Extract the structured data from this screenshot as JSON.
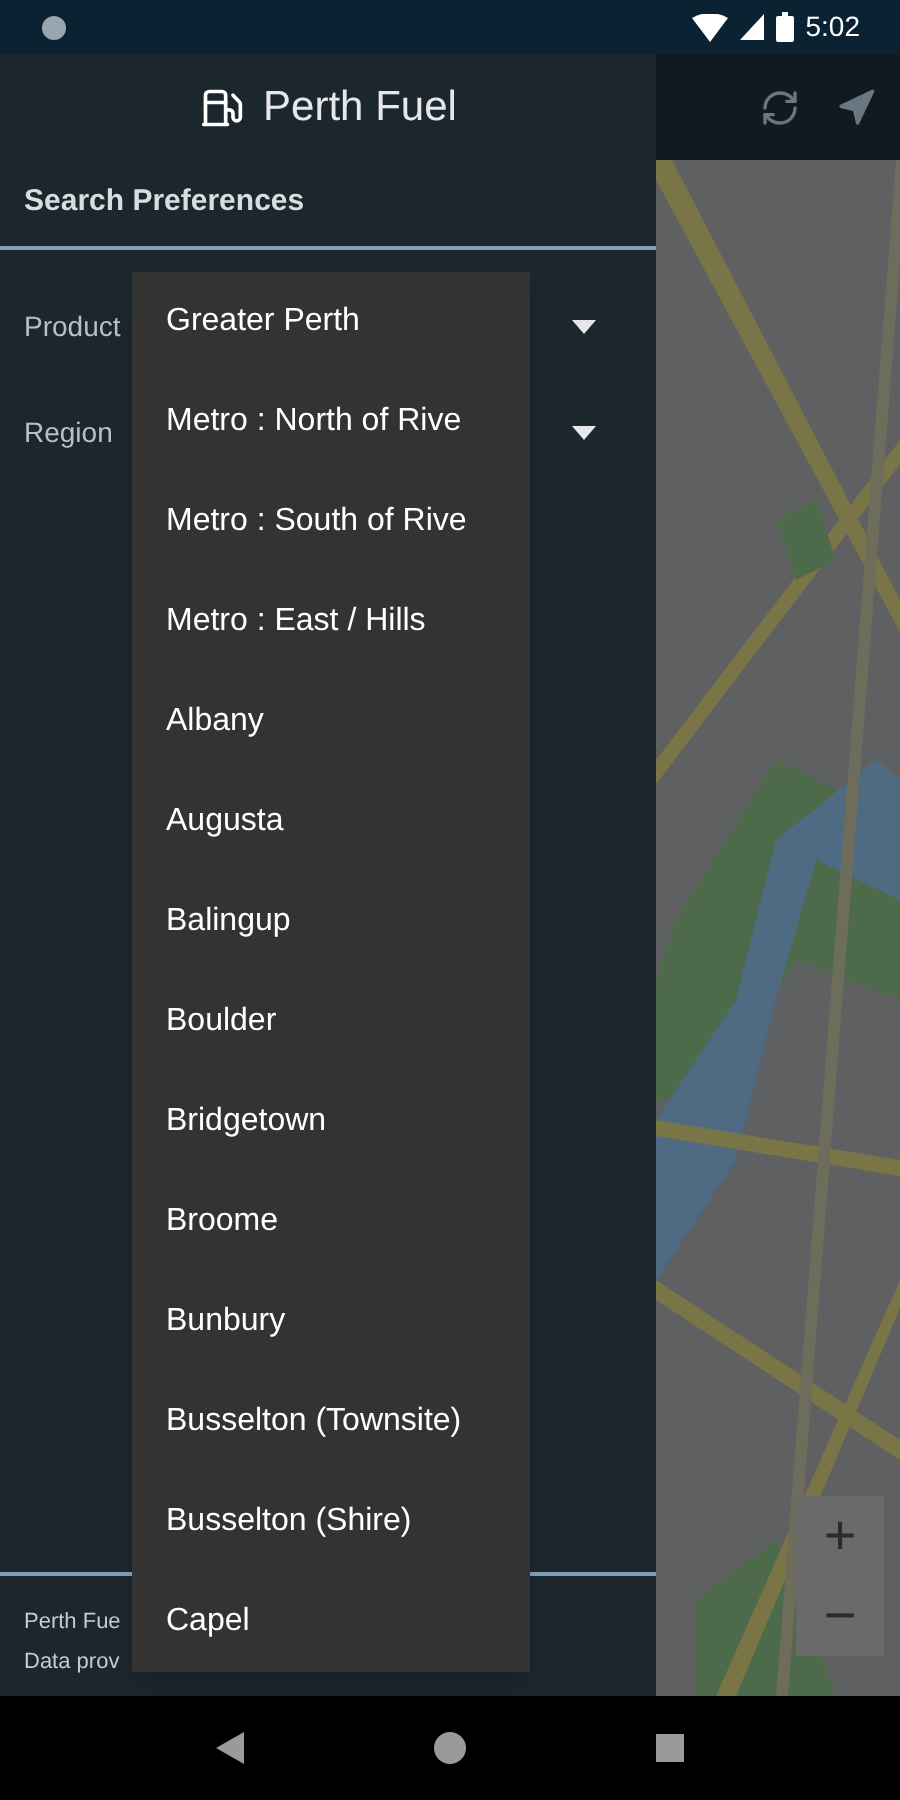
{
  "status_bar": {
    "time": "5:02"
  },
  "drawer": {
    "title": "Perth Fuel",
    "section": "Search Preferences",
    "fields": [
      {
        "label": "Product"
      },
      {
        "label": "Region"
      }
    ],
    "footer": [
      "Perth Fue",
      "Data prov"
    ]
  },
  "dropdown": {
    "items": [
      {
        "label": "Greater Perth"
      },
      {
        "label": "Metro : North of Rive"
      },
      {
        "label": "Metro : South of Rive"
      },
      {
        "label": "Metro : East / Hills"
      },
      {
        "label": "Albany"
      },
      {
        "label": "Augusta"
      },
      {
        "label": "Balingup"
      },
      {
        "label": "Boulder"
      },
      {
        "label": "Bridgetown"
      },
      {
        "label": "Broome"
      },
      {
        "label": "Bunbury"
      },
      {
        "label": "Busselton (Townsite)"
      },
      {
        "label": "Busselton (Shire)"
      },
      {
        "label": "Capel"
      }
    ]
  },
  "map": {
    "zoom_in": "+",
    "zoom_out": "−"
  }
}
